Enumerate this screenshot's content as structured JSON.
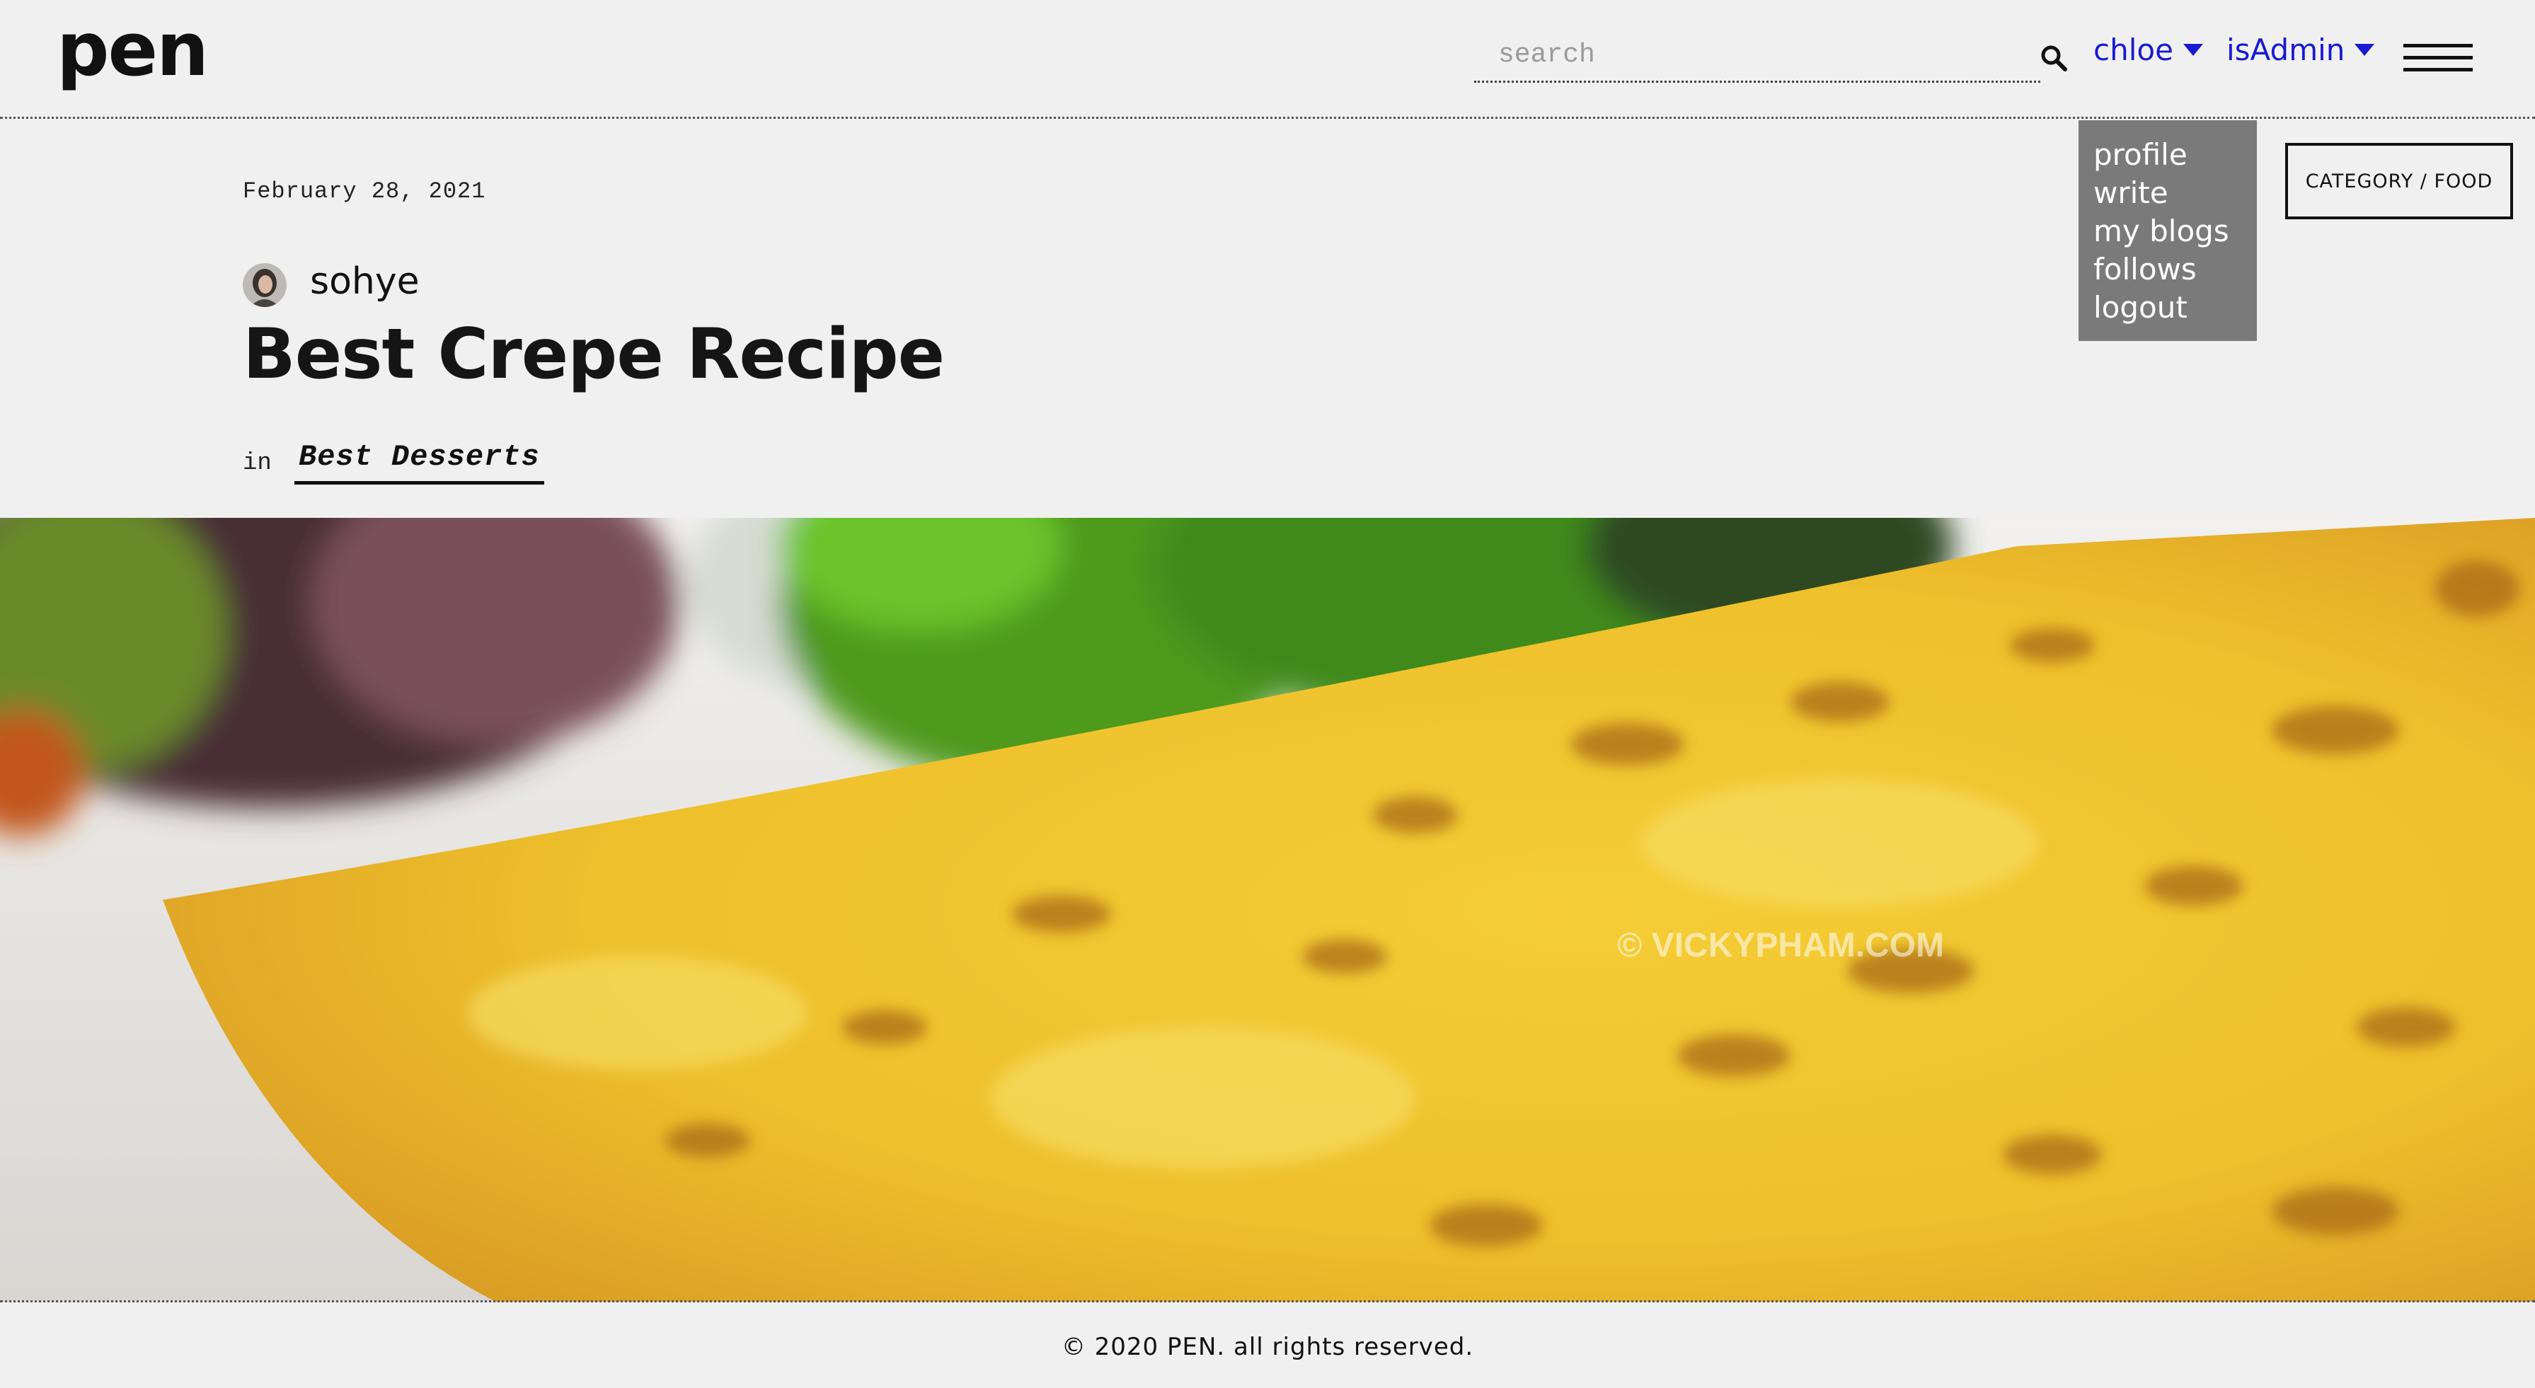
{
  "header": {
    "logo": "pen",
    "search_placeholder": "search",
    "user_menu_label": "chloe",
    "admin_menu_label": "isAdmin"
  },
  "user_dropdown": {
    "items": [
      "profile",
      "write",
      "my blogs",
      "follows",
      "logout"
    ]
  },
  "category_badge": "CATEGORY / FOOD",
  "post": {
    "date": "February 28, 2021",
    "author": "sohye",
    "title": "Best Crepe Recipe",
    "in_label": "in",
    "blog_name": "Best Desserts"
  },
  "hero_image": {
    "subject": "crepe-photo",
    "watermark": "© VICKYPHAM.COM"
  },
  "footer": {
    "copyright": "© 2020 PEN. all rights reserved."
  },
  "colors": {
    "background": "#f0f0f0",
    "link_blue": "#1a1ad0",
    "dropdown_bg": "#7a7a7a",
    "text": "#111111"
  }
}
